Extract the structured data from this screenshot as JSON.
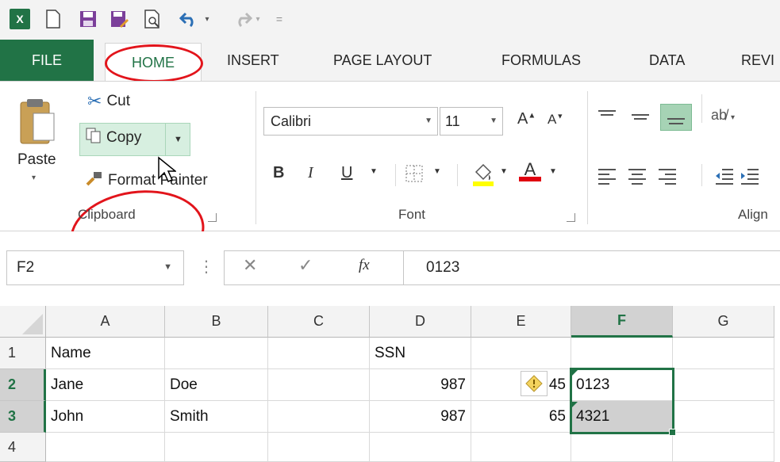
{
  "qat": {
    "app_icon": "excel-icon",
    "app_letter": "X",
    "sep": "="
  },
  "tabs": {
    "file": "FILE",
    "home": "HOME",
    "insert": "INSERT",
    "page_layout": "PAGE LAYOUT",
    "formulas": "FORMULAS",
    "data": "DATA",
    "review": "REVI"
  },
  "clipboard": {
    "paste": "Paste",
    "cut": "Cut",
    "copy": "Copy",
    "format_painter": "Format Painter",
    "label": "Clipboard"
  },
  "font": {
    "name": "Calibri",
    "size": "11",
    "bold": "B",
    "italic": "I",
    "underline": "U",
    "grow": "A",
    "shrink": "A",
    "font_color": "A",
    "label": "Font"
  },
  "alignment": {
    "label": "Align"
  },
  "formula_bar": {
    "name_box": "F2",
    "cancel": "✕",
    "enter": "✓",
    "fx": "fx",
    "value": "0123"
  },
  "grid": {
    "columns": [
      "A",
      "B",
      "C",
      "D",
      "E",
      "F",
      "G"
    ],
    "rows": [
      "1",
      "2",
      "3",
      "4"
    ],
    "cells": {
      "A1": "Name",
      "D1": "SSN",
      "A2": "Jane",
      "B2": "Doe",
      "D2": "987",
      "E2": "45",
      "F2": "0123",
      "A3": "John",
      "B3": "Smith",
      "D3": "987",
      "E3": "65",
      "F3": "4321"
    },
    "selected_column": "F"
  },
  "colors": {
    "excel_green": "#217346",
    "annotation_red": "#e2141b",
    "selection_fill": "#d0d0d0"
  }
}
